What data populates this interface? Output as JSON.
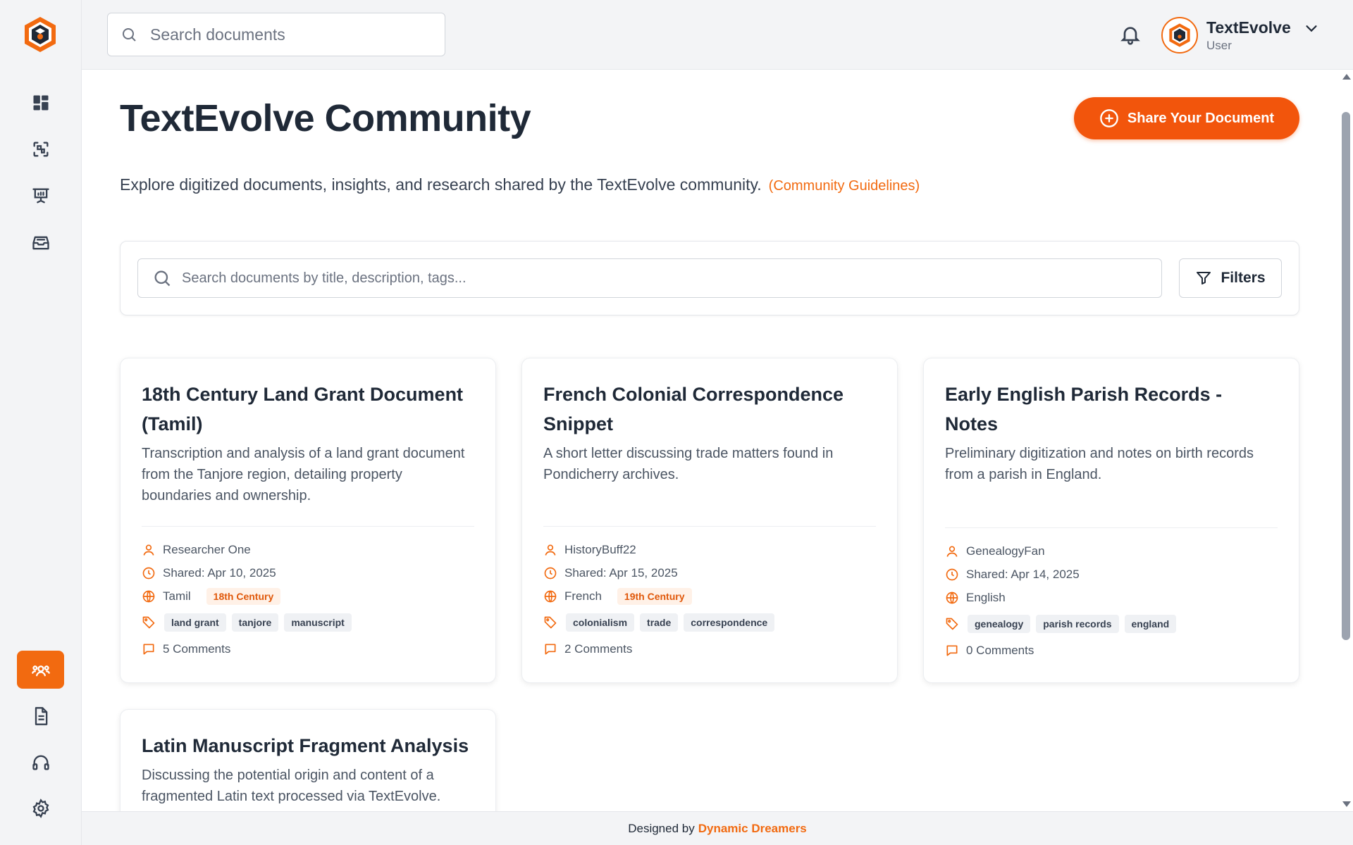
{
  "sidebar": {
    "items": [
      {
        "icon": "dashboard-icon"
      },
      {
        "icon": "scan-icon"
      },
      {
        "icon": "presentation-icon"
      },
      {
        "icon": "inbox-icon"
      },
      {
        "icon": "community-icon",
        "active": true
      },
      {
        "icon": "document-icon"
      },
      {
        "icon": "headphones-icon"
      },
      {
        "icon": "settings-icon"
      }
    ]
  },
  "header": {
    "search_placeholder": "Search documents",
    "user": {
      "name": "TextEvolve",
      "role": "User"
    }
  },
  "main": {
    "title": "TextEvolve Community",
    "share_button": "Share Your Document",
    "subtitle": "Explore digitized documents, insights, and research shared by the TextEvolve community.",
    "guidelines_link": "(Community Guidelines)",
    "doc_search_placeholder": "Search documents by title, description, tags...",
    "filters_label": "Filters",
    "cards": [
      {
        "title": "18th Century Land Grant Document (Tamil)",
        "description": "Transcription and analysis of a land grant document from the Tanjore region, detailing property boundaries and ownership.",
        "author": "Researcher One",
        "shared": "Shared: Apr 10, 2025",
        "language": "Tamil",
        "century": "18th Century",
        "tags": [
          "land grant",
          "tanjore",
          "manuscript"
        ],
        "comments": "5 Comments"
      },
      {
        "title": "French Colonial Correspondence Snippet",
        "description": "A short letter discussing trade matters found in Pondicherry archives.",
        "author": "HistoryBuff22",
        "shared": "Shared: Apr 15, 2025",
        "language": "French",
        "century": "19th Century",
        "tags": [
          "colonialism",
          "trade",
          "correspondence"
        ],
        "comments": "2 Comments"
      },
      {
        "title": "Early English Parish Records - Notes",
        "description": "Preliminary digitization and notes on birth records from a parish in England.",
        "author": "GenealogyFan",
        "shared": "Shared: Apr 14, 2025",
        "language": "English",
        "century": "",
        "tags": [
          "genealogy",
          "parish records",
          "england"
        ],
        "comments": "0 Comments"
      },
      {
        "title": "Latin Manuscript Fragment Analysis",
        "description": "Discussing the potential origin and content of a fragmented Latin text processed via TextEvolve."
      }
    ]
  },
  "footer": {
    "prefix": "Designed by",
    "brand": "Dynamic Dreamers"
  },
  "colors": {
    "accent": "#f26a10",
    "share_button": "#f2550c",
    "badge_bg": "#fff1e7"
  }
}
